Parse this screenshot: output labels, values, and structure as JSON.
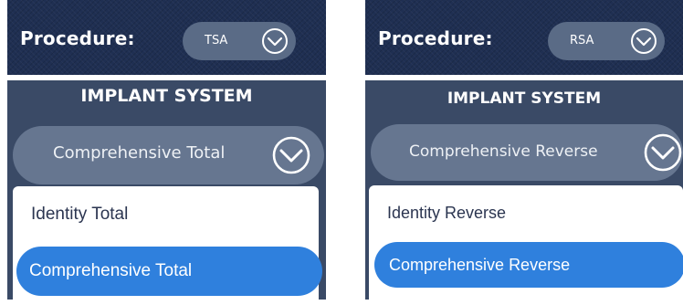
{
  "panels": [
    {
      "procedure_label": "Procedure:",
      "procedure_value": "TSA",
      "implant_title": "IMPLANT SYSTEM",
      "selected_system": "Comprehensive Total",
      "options": [
        "Identity Total",
        "Comprehensive Total"
      ]
    },
    {
      "procedure_label": "Procedure:",
      "procedure_value": "RSA",
      "implant_title": "IMPLANT SYSTEM",
      "selected_system": "Comprehensive Reverse",
      "options": [
        "Identity Reverse",
        "Comprehensive Reverse"
      ]
    }
  ],
  "icons": {
    "dropdown": "chevron-down-circle-icon"
  },
  "colors": {
    "header_bg": "#1f2f52",
    "card_bg": "#3a4a66",
    "select_bg": "#667690",
    "highlight": "#2f80dd"
  }
}
